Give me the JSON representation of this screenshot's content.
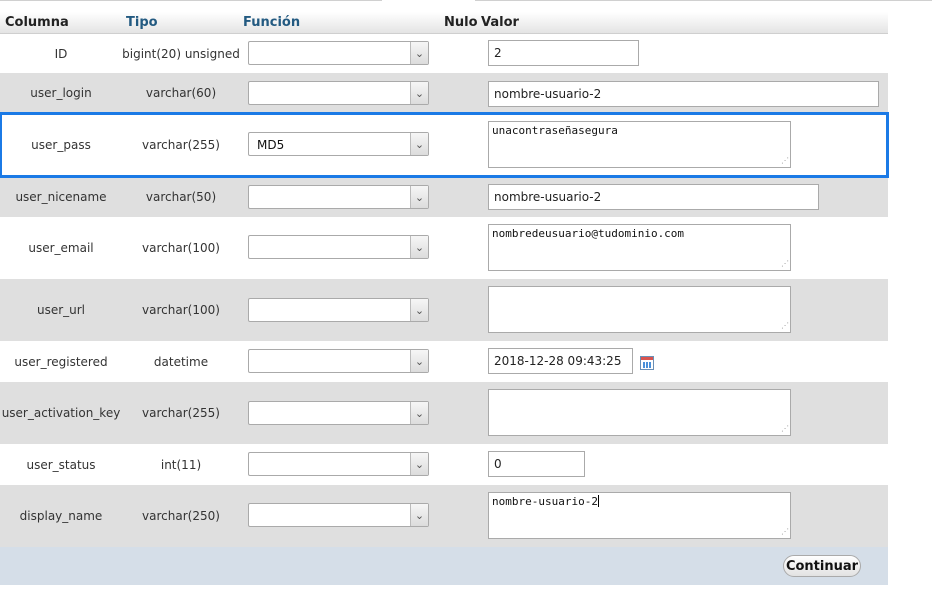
{
  "header": {
    "col_column": "Columna",
    "col_type": "Tipo",
    "col_function": "Función",
    "col_null": "Nulo",
    "col_value": "Valor"
  },
  "rows": [
    {
      "column": "ID",
      "type": "bigint(20) unsigned",
      "function": "",
      "value": "2"
    },
    {
      "column": "user_login",
      "type": "varchar(60)",
      "function": "",
      "value": "nombre-usuario-2"
    },
    {
      "column": "user_pass",
      "type": "varchar(255)",
      "function": "MD5",
      "value": "unacontraseñasegura"
    },
    {
      "column": "user_nicename",
      "type": "varchar(50)",
      "function": "",
      "value": "nombre-usuario-2"
    },
    {
      "column": "user_email",
      "type": "varchar(100)",
      "function": "",
      "value": "nombredeusuario@tudominio.com"
    },
    {
      "column": "user_url",
      "type": "varchar(100)",
      "function": "",
      "value": ""
    },
    {
      "column": "user_registered",
      "type": "datetime",
      "function": "",
      "value": "2018-12-28 09:43:25"
    },
    {
      "column": "user_activation_key",
      "type": "varchar(255)",
      "function": "",
      "value": ""
    },
    {
      "column": "user_status",
      "type": "int(11)",
      "function": "",
      "value": "0"
    },
    {
      "column": "display_name",
      "type": "varchar(250)",
      "function": "",
      "value": "nombre-usuario-2"
    }
  ],
  "footer": {
    "continue_label": "Continuar"
  },
  "icons": {
    "dropdown": "chevron-down-icon",
    "calendar": "calendar-icon",
    "resize": "resize-grip-icon"
  },
  "colors": {
    "highlight": "#1b7ae6",
    "header_link": "#235a81",
    "footer_bg": "#d5dee8"
  }
}
